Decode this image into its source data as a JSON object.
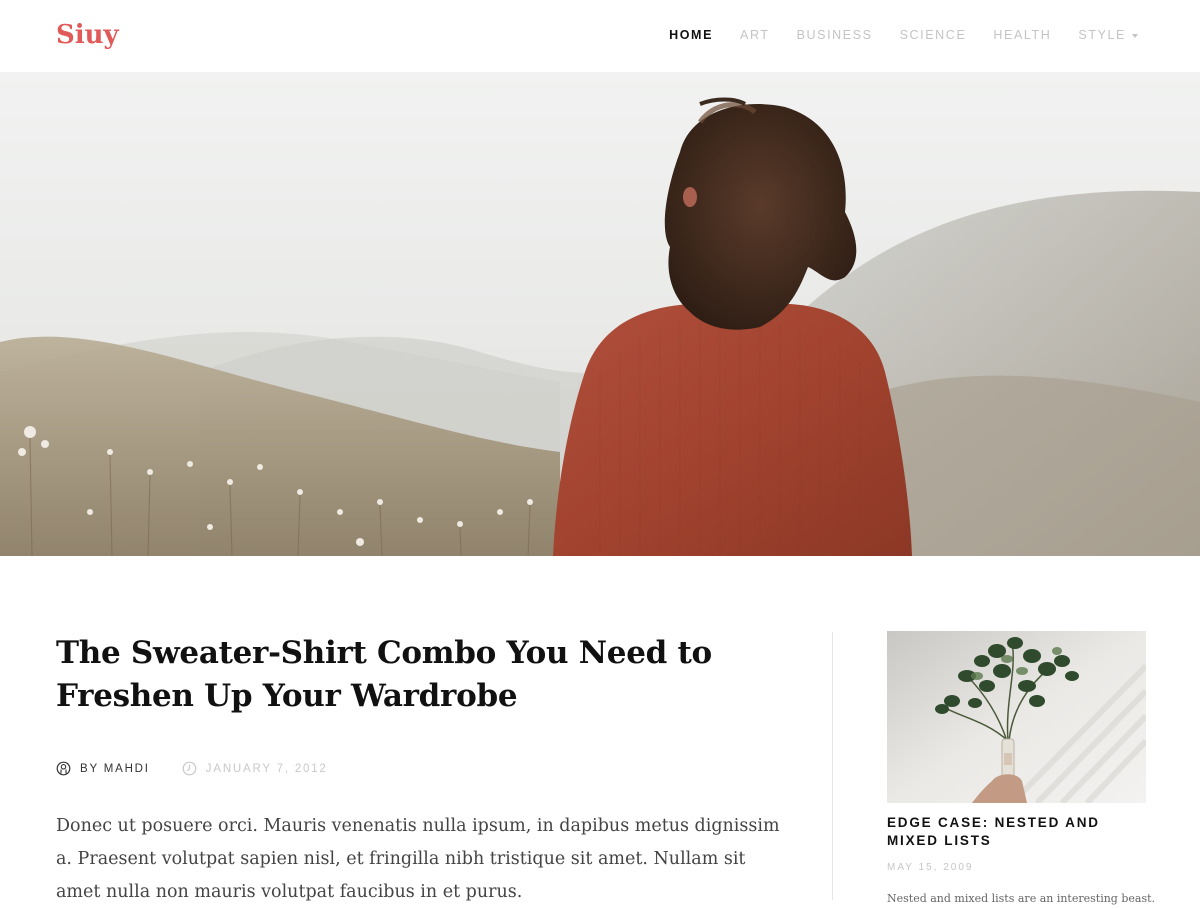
{
  "header": {
    "logo": "Siuy",
    "nav": [
      {
        "label": "HOME",
        "active": true
      },
      {
        "label": "ART",
        "active": false
      },
      {
        "label": "BUSINESS",
        "active": false
      },
      {
        "label": "SCIENCE",
        "active": false
      },
      {
        "label": "HEALTH",
        "active": false
      },
      {
        "label": "STYLE",
        "active": false,
        "has_dropdown": true
      }
    ]
  },
  "colors": {
    "brand": "#e05a5a",
    "nav_inactive": "#c4c4c4",
    "text_dark": "#111111",
    "meta_muted": "#c8c8c8"
  },
  "hero": {
    "icon": "hero-photo-woman-red-sweater"
  },
  "article": {
    "title": "The Sweater-Shirt Combo You Need to Freshen Up Your Wardrobe",
    "author": "BY MAHDI",
    "author_icon": "author-icon",
    "date": "JANUARY 7, 2012",
    "date_icon": "clock-icon",
    "excerpt": "Donec ut posuere orci. Mauris venenatis nulla ipsum, in dapibus metus dignissim a. Praesent volutpat sapien nisl, et fringilla nibh tristique sit amet. Nullam sit amet nulla non mauris volutpat faucibus in et purus."
  },
  "sidebar": {
    "post": {
      "title": "EDGE CASE: NESTED AND MIXED LISTS",
      "date": "MAY 15, 2009",
      "excerpt": "Nested and mixed lists are an interesting beast."
    }
  }
}
